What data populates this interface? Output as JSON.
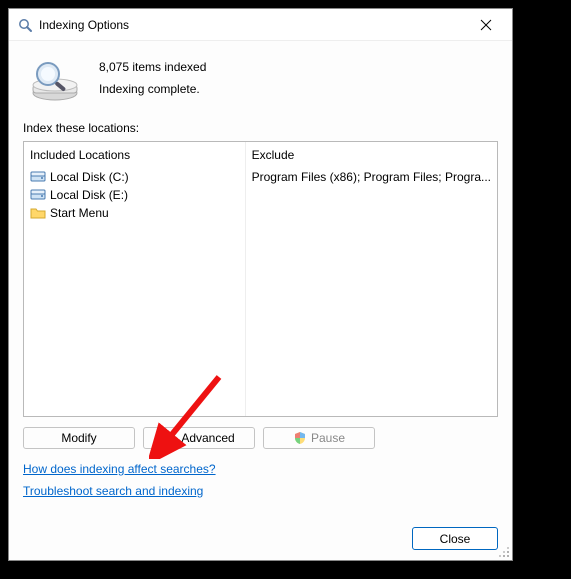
{
  "window": {
    "title": "Indexing Options"
  },
  "status": {
    "count_text": "8,075 items indexed",
    "state_text": "Indexing complete."
  },
  "locations_label": "Index these locations:",
  "columns": {
    "included_header": "Included Locations",
    "exclude_header": "Exclude"
  },
  "locations": {
    "items": [
      {
        "label": "Local Disk (C:)",
        "icon": "drive",
        "exclude": "Program Files (x86); Program Files; Progra..."
      },
      {
        "label": "Local Disk (E:)",
        "icon": "drive",
        "exclude": ""
      },
      {
        "label": "Start Menu",
        "icon": "folder",
        "exclude": ""
      }
    ]
  },
  "buttons": {
    "modify": "Modify",
    "advanced": "Advanced",
    "pause": "Pause",
    "close": "Close"
  },
  "links": {
    "how": "How does indexing affect searches?",
    "troubleshoot": "Troubleshoot search and indexing"
  }
}
